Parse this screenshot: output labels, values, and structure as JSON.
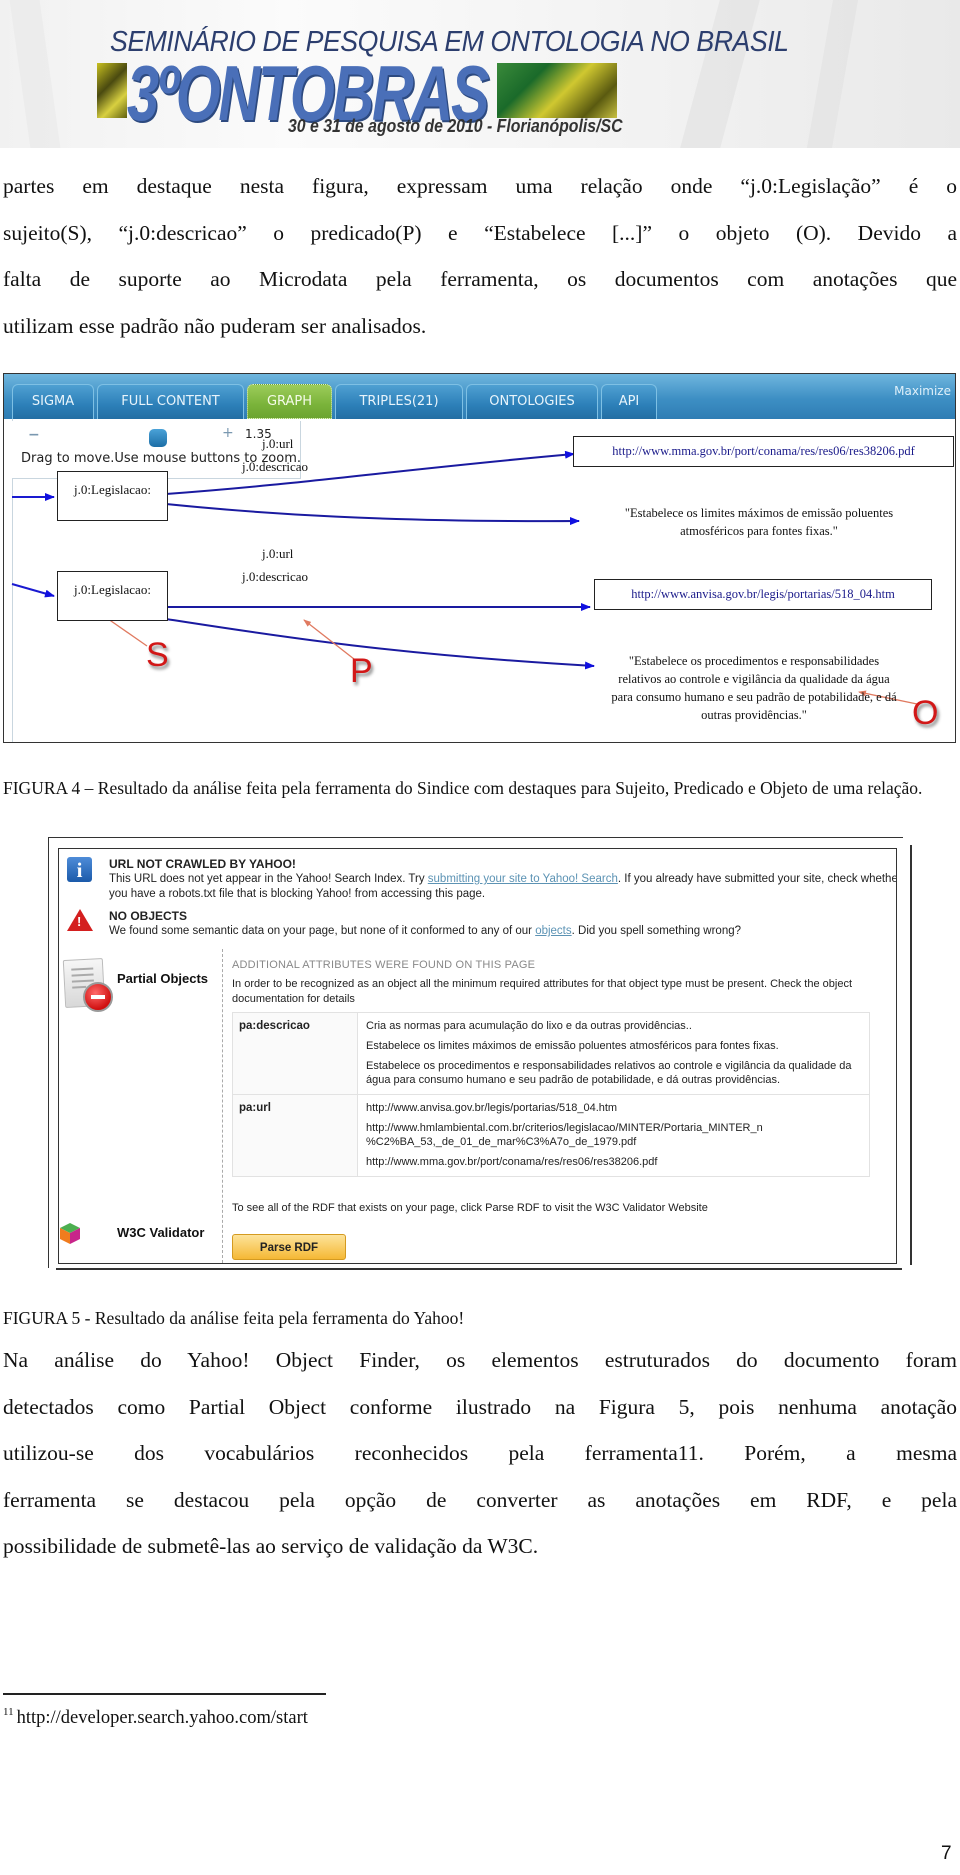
{
  "banner": {
    "subtitle": "SEMINÁRIO DE PESQUISA EM ONTOLOGIA NO BRASIL",
    "logo": "3ºONTOBRAS",
    "dates": "30 e 31 de agosto de 2010 - Florianópolis/SC"
  },
  "paragraph1": {
    "lines": [
      "partes em destaque nesta figura, expressam uma relação onde “j.0:Legislação” é o",
      "sujeito(S), “j.0:descricao” o predicado(P) e “Estabelece [...]” o objeto (O). Devido a",
      "falta de suporte ao Microdata pela ferramenta, os documentos com anotações que",
      "utilizam esse padrão não puderam ser analisados."
    ]
  },
  "figure4": {
    "tabs": [
      {
        "label": "SIGMA",
        "active": false
      },
      {
        "label": "FULL CONTENT",
        "active": false
      },
      {
        "label": "GRAPH",
        "active": true
      },
      {
        "label": "TRIPLES(21)",
        "active": false
      },
      {
        "label": "ONTOLOGIES",
        "active": false
      },
      {
        "label": "API",
        "active": false
      }
    ],
    "maximize_label": "Maximize",
    "zoom": {
      "minus": "−",
      "plus": "+",
      "level": "1.35",
      "hint": "Drag to move.Use mouse buttons to zoom."
    },
    "graph": {
      "triple1": {
        "subject": "j.0:Legislacao:",
        "predicate_url": "j.0:url",
        "predicate_desc": "j.0:descricao",
        "url_object": "http://www.mma.gov.br/port/conama/res/res06/res38206.pdf",
        "literal_object": "\"Estabelece os limites máximos de emissão poluentes atmosféricos para fontes fixas.\""
      },
      "triple2": {
        "subject": "j.0:Legislacao:",
        "predicate_url": "j.0:url",
        "predicate_desc": "j.0:descricao",
        "url_object": "http://www.anvisa.gov.br/legis/portarias/518_04.htm",
        "literal_object": "\"Estabelece os procedimentos e responsabilidades relativos ao controle e vigilância da qualidade da água para consumo humano e seu padrão de potabilidade, e dá outras providências.\""
      },
      "annotations": {
        "subject": "S",
        "predicate": "P",
        "object": "O"
      }
    },
    "colors": {
      "tab_blue": "#2f7db4",
      "tab_active": "#7ab33a",
      "edge": "#1a1ad0",
      "annotation": "#d21818"
    }
  },
  "caption4": "FIGURA 4 – Resultado da análise feita pela ferramenta do Sindice com destaques para Sujeito, Predicado e Objeto de uma relação.",
  "figure5": {
    "not_crawled": {
      "title": "URL NOT CRAWLED BY YAHOO!",
      "line1_pre": "This URL does not yet appear in the Yahoo! Search Index. Try ",
      "line1_link": "submitting your site to Yahoo! Search",
      "line1_post": ". If you already have submitted your site, check whether",
      "line2": "you have a robots.txt file that is blocking Yahoo! from accessing this page."
    },
    "no_objects": {
      "title": "NO OBJECTS",
      "line_pre": "We found some semantic data on your page, but none of it conformed to any of our ",
      "line_link": "objects",
      "line_post": ". Did you spell something wrong?"
    },
    "partial_objects_label": "Partial Objects",
    "additional": {
      "title": "ADDITIONAL ATTRIBUTES WERE FOUND ON THIS PAGE",
      "description": "In order to be recognized as an object all the minimum required attributes for that object type must be present. Check the object documentation for details"
    },
    "attributes": [
      {
        "key": "pa:descricao",
        "values": [
          "Cria as normas para acumulação do lixo e da outras providências..",
          "Estabelece os limites máximos de emissão poluentes atmosféricos para fontes fixas.",
          "Estabelece os procedimentos e responsabilidades relativos ao controle e vigilância da qualidade da água para consumo humano e seu padrão de potabilidade, e dá outras providências."
        ]
      },
      {
        "key": "pa:url",
        "values": [
          "http://www.anvisa.gov.br/legis/portarias/518_04.htm",
          "http://www.hmlambiental.com.br/criterios/legislacao/MINTER/Portaria_MINTER_n %C2%BA_53,_de_01_de_mar%C3%A7o_de_1979.pdf",
          "http://www.mma.gov.br/port/conama/res/res06/res38206.pdf"
        ]
      }
    ],
    "w3c_label": "W3C Validator",
    "rdf_description": "To see all of the RDF that exists on your page, click Parse RDF to visit the W3C Validator Website",
    "parse_button": "Parse RDF"
  },
  "caption5": "FIGURA 5 - Resultado da análise feita pela ferramenta do Yahoo!",
  "paragraph2": {
    "lines": [
      "Na análise do Yahoo! Object Finder, os elementos estruturados do documento foram",
      "detectados como Partial Object conforme ilustrado na Figura 5, pois nenhuma anotação",
      "utilizou-se dos vocabulários reconhecidos pela ferramenta11. Porém, a mesma",
      "ferramenta se destacou pela opção de converter as anotações em RDF, e pela",
      "possibilidade de submetê-las ao serviço de validação da W3C."
    ]
  },
  "footnote": {
    "number": "11",
    "text": "http://developer.search.yahoo.com/start"
  },
  "page_number": "7"
}
